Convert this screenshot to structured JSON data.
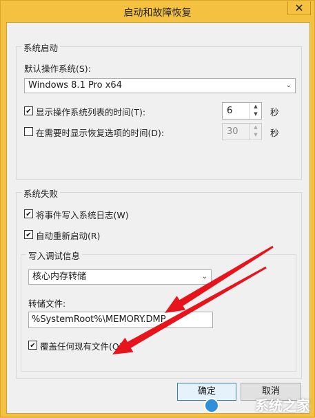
{
  "window": {
    "title": "启动和故障恢复",
    "close_glyph": "✕"
  },
  "system_startup": {
    "legend": "系统启动",
    "default_os_label": "默认操作系统(S):",
    "default_os_value": "Windows 8.1 Pro x64",
    "show_list_label": "显示操作系统列表的时间(T):",
    "show_list_checked": true,
    "show_list_value": "6",
    "show_list_unit": "秒",
    "show_recovery_label": "在需要时显示恢复选项的时间(D):",
    "show_recovery_checked": false,
    "show_recovery_value": "30",
    "show_recovery_unit": "秒"
  },
  "system_failure": {
    "legend": "系统失败",
    "write_log_label": "将事件写入系统日志(W)",
    "write_log_checked": true,
    "auto_restart_label": "自动重新启动(R)",
    "auto_restart_checked": true,
    "debug_info": {
      "legend": "写入调试信息",
      "type_value": "核心内存转储",
      "dump_file_label": "转储文件:",
      "dump_file_value": "%SystemRoot%\\MEMORY.DMP",
      "overwrite_label": "覆盖任何现有文件(O)",
      "overwrite_checked": true
    }
  },
  "buttons": {
    "ok_label": "确定",
    "cancel_label": "取消"
  },
  "annotation": {
    "arrow_color": "#e8141b"
  },
  "watermark": {
    "text": "系统之家"
  }
}
